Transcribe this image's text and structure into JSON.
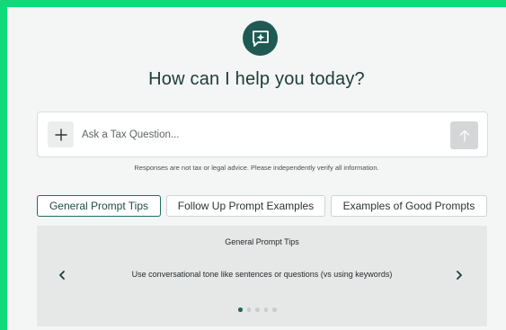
{
  "header": {
    "title": "How can I help you today?"
  },
  "search": {
    "placeholder": "Ask a Tax Question..."
  },
  "disclaimer": "Responses are not tax or legal advice. Please independently verify all information.",
  "tabs": [
    {
      "label": "General Prompt Tips",
      "active": true
    },
    {
      "label": "Follow Up Prompt Examples",
      "active": false
    },
    {
      "label": "Examples of Good Prompts",
      "active": false
    }
  ],
  "carousel": {
    "title": "General Prompt Tips",
    "tip": "Use conversational tone like sentences or questions (vs using keywords)",
    "total_slides": 5,
    "current_slide": 1
  },
  "icons": {
    "logo": "chat-sparkle-icon",
    "add": "plus-icon",
    "send": "arrow-up-icon",
    "prev": "chevron-left-icon",
    "next": "chevron-right-icon"
  },
  "colors": {
    "background": "#10d97a",
    "brand": "#1e5a53",
    "surface": "#f4f5f5",
    "active_tab_border": "#1f6d61",
    "active_dot": "#1f6a60"
  }
}
